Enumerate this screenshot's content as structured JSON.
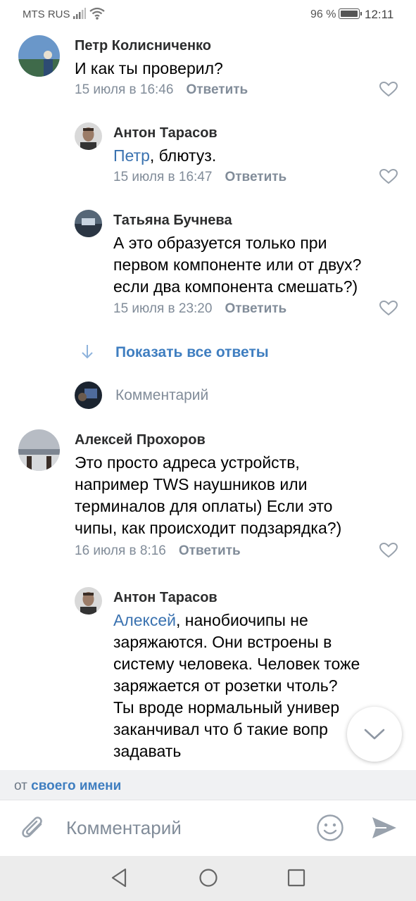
{
  "status_bar": {
    "carrier": "MTS RUS",
    "battery": "96 %",
    "time": "12:11",
    "icons": [
      "signal-icon",
      "wifi-icon",
      "battery-icon"
    ]
  },
  "comments": [
    {
      "author": "Петр Колисниченко",
      "mention": "",
      "text": "И как ты проверил?",
      "date": "15 июля в 16:46",
      "reply_label": "Ответить"
    },
    {
      "author": "Антон Тарасов",
      "mention": "Петр",
      "text": ", блютуз.",
      "date": "15 июля в 16:47",
      "reply_label": "Ответить"
    },
    {
      "author": "Татьяна Бучнева",
      "mention": "",
      "text_lines": [
        "А это образуется только при",
        "первом компоненте или от двух?",
        "если два компонента смешать?)"
      ],
      "date": "15 июля в 23:20",
      "reply_label": "Ответить"
    },
    {
      "author": "Алексей Прохоров",
      "mention": "",
      "text_lines": [
        "Это просто адреса устройств,",
        "например TWS наушников или",
        "терминалов для оплаты) Если это",
        "чипы, как происходит подзарядка?)"
      ],
      "date": "16 июля в 8:16",
      "reply_label": "Ответить"
    },
    {
      "author": "Антон Тарасов",
      "mention": "Алексей",
      "text_lines": [
        ", нанобиочипы не",
        "заряжаются. Они встроены в",
        "систему человека. Человек тоже",
        "заряжается от розетки чтоль?",
        "Ты вроде нормальный универ",
        "заканчивал что б такие вопр",
        "задавать"
      ]
    }
  ],
  "show_all_replies": "Показать все ответы",
  "reply_placeholder": "Комментарий",
  "from_bar": {
    "prefix": "от",
    "name": "своего имени"
  },
  "composer": {
    "placeholder": "Комментарий"
  },
  "colors": {
    "accent": "#3f7ec0",
    "meta": "#818c99",
    "from_bar_bg": "#f0f1f3",
    "nav_bg": "#ececec"
  }
}
